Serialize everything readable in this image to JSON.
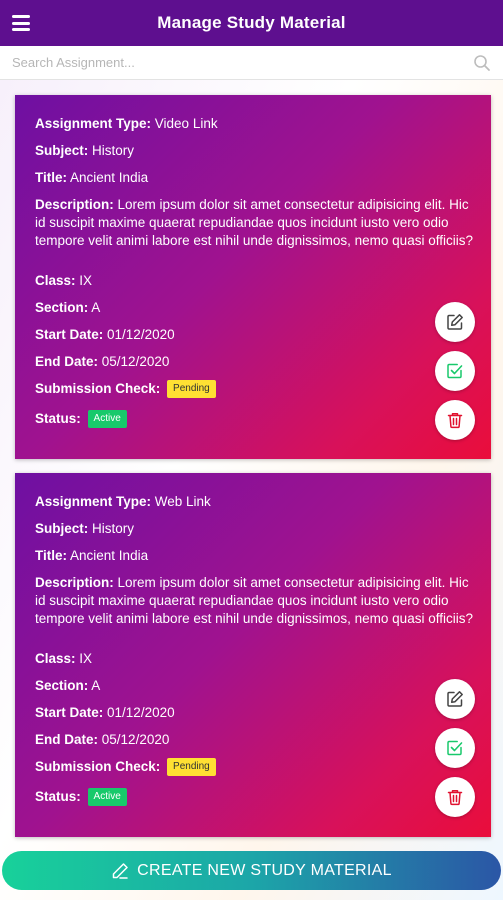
{
  "header": {
    "title": "Manage Study Material"
  },
  "search": {
    "placeholder": "Search Assignment..."
  },
  "labels": {
    "assignment_type": "Assignment Type:",
    "subject": "Subject:",
    "title": "Title:",
    "description": "Description:",
    "class": "Class:",
    "section": "Section:",
    "start_date": "Start Date:",
    "end_date": "End Date:",
    "submission_check": "Submission Check:",
    "status": "Status:"
  },
  "cards": [
    {
      "assignment_type": "Video Link",
      "subject": "History",
      "title": "Ancient India",
      "description": "Lorem ipsum dolor sit amet consectetur adipisicing elit. Hic id suscipit maxime quaerat repudiandae quos incidunt iusto vero odio tempore velit animi labore est nihil unde dignissimos, nemo quasi officiis?",
      "class": "IX",
      "section": "A",
      "start_date": "01/12/2020",
      "end_date": "05/12/2020",
      "submission_check": "Pending",
      "status": "Active"
    },
    {
      "assignment_type": "Web Link",
      "subject": "History",
      "title": "Ancient India",
      "description": "Lorem ipsum dolor sit amet consectetur adipisicing elit. Hic id suscipit maxime quaerat repudiandae quos incidunt iusto vero odio tempore velit animi labore est nihil unde dignissimos, nemo quasi officiis?",
      "class": "IX",
      "section": "A",
      "start_date": "01/12/2020",
      "end_date": "05/12/2020",
      "submission_check": "Pending",
      "status": "Active"
    }
  ],
  "actions": {
    "edit_icon": "edit-icon",
    "check_icon": "check-square-icon",
    "delete_icon": "trash-icon"
  },
  "footer": {
    "create_label": "CREATE NEW STUDY MATERIAL"
  },
  "colors": {
    "app_bar": "#5e0f8f",
    "card_start": "#6e10a2",
    "card_end": "#ea0d3b",
    "pending": "#ffe033",
    "active": "#18c96b",
    "edit": "#444444",
    "check": "#18c96b",
    "delete": "#e0112f"
  }
}
